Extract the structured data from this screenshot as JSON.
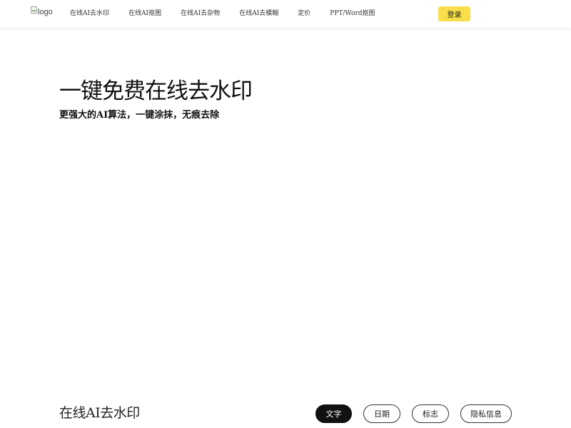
{
  "header": {
    "logo_alt": "logo",
    "nav": [
      {
        "label": "在线AI去水印"
      },
      {
        "label": "在线AI抠图"
      },
      {
        "label": "在线AI去杂物"
      },
      {
        "label": "在线AI去模糊"
      },
      {
        "label": "定价"
      },
      {
        "label": "PPT/Word抠图"
      }
    ],
    "login_label": "登录"
  },
  "hero": {
    "title": "一键免费在线去水印",
    "subtitle": "更强大的AI算法，一键涂抹，无痕去除"
  },
  "section": {
    "title": "在线AI去水印",
    "tabs": [
      {
        "label": "文字",
        "active": true
      },
      {
        "label": "日期",
        "active": false
      },
      {
        "label": "标志",
        "active": false
      },
      {
        "label": "隐私信息",
        "active": false
      }
    ]
  },
  "colors": {
    "login_button": "#f8df4a",
    "active_tab": "#111111"
  }
}
